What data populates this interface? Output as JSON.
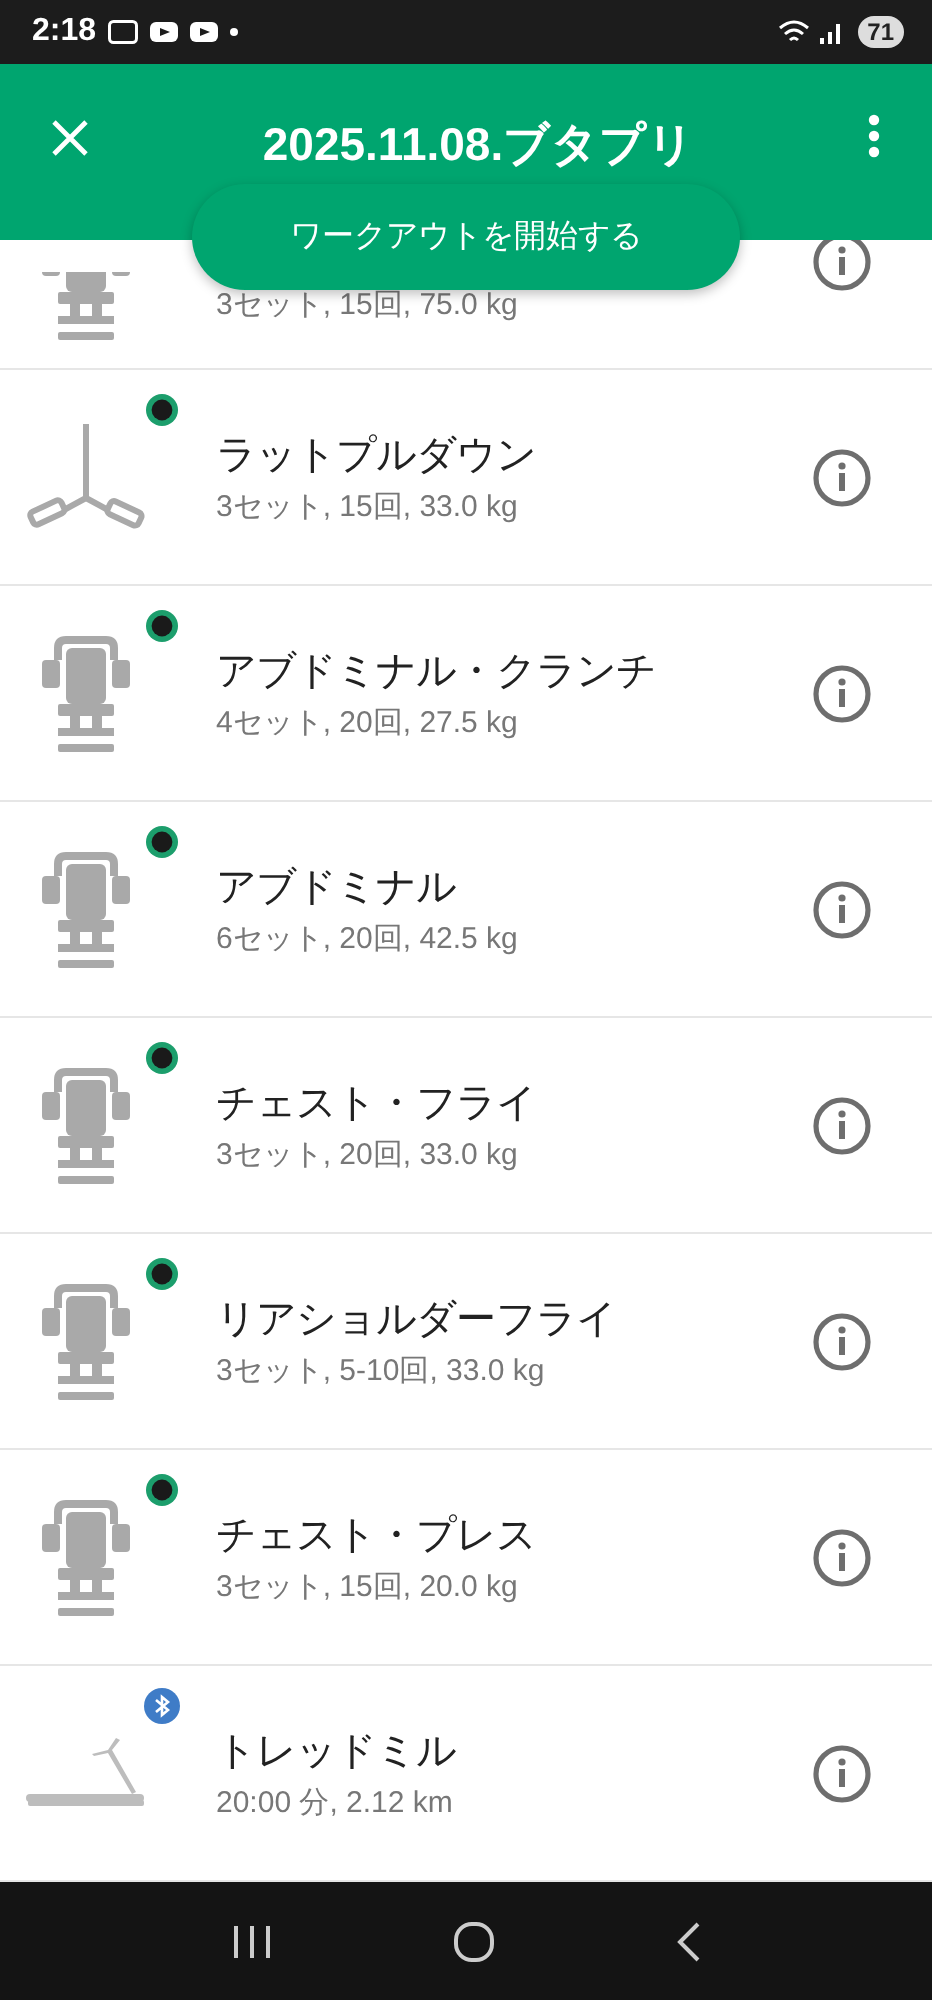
{
  "status_bar": {
    "time": "2:18",
    "battery": "71"
  },
  "header": {
    "title": "2025.11.08.ブタプリ"
  },
  "start_button": "ワークアウトを開始する",
  "exercises": [
    {
      "kind": "seat",
      "tracked": false,
      "bluetooth": false,
      "detail": "3セット, 15回, 75.0 kg"
    },
    {
      "kind": "cable",
      "tracked": true,
      "bluetooth": false,
      "name": "ラットプルダウン",
      "detail": "3セット, 15回, 33.0 kg"
    },
    {
      "kind": "seat",
      "tracked": true,
      "bluetooth": false,
      "name": "アブドミナル・クランチ",
      "detail": "4セット, 20回, 27.5 kg"
    },
    {
      "kind": "seat",
      "tracked": true,
      "bluetooth": false,
      "name": "アブドミナル",
      "detail": "6セット, 20回, 42.5 kg"
    },
    {
      "kind": "seat",
      "tracked": true,
      "bluetooth": false,
      "name": "チェスト・フライ",
      "detail": "3セット, 20回, 33.0 kg"
    },
    {
      "kind": "seat",
      "tracked": true,
      "bluetooth": false,
      "name": "リアショルダーフライ",
      "detail": "3セット, 5-10回, 33.0 kg"
    },
    {
      "kind": "seat",
      "tracked": true,
      "bluetooth": false,
      "name": "チェスト・プレス",
      "detail": "3セット, 15回, 20.0 kg"
    },
    {
      "kind": "treadmill",
      "tracked": false,
      "bluetooth": true,
      "name": "トレッドミル",
      "detail": "20:00 分, 2.12 km"
    }
  ]
}
